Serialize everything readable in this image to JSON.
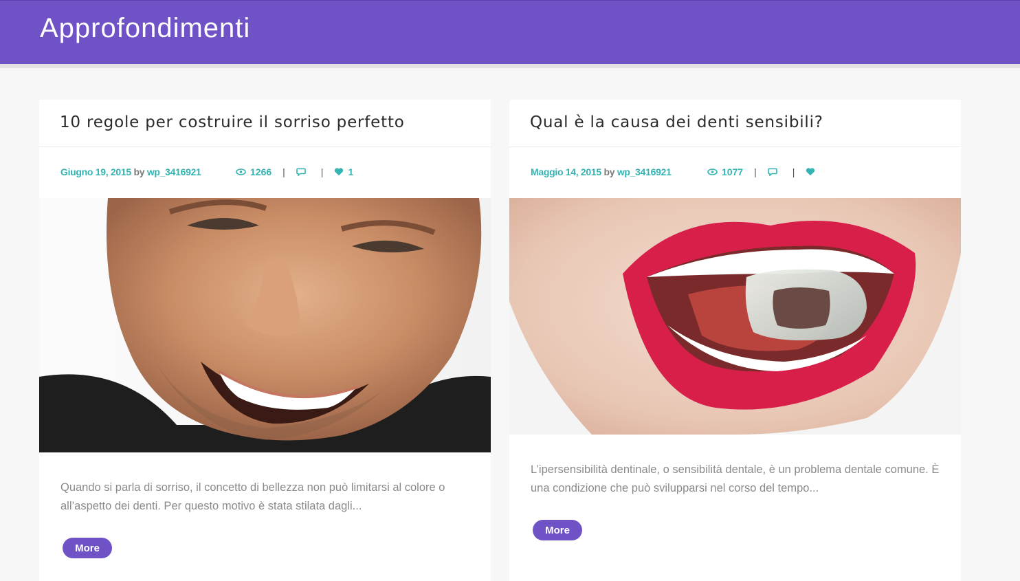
{
  "header": {
    "title": "Approfondimenti"
  },
  "posts": [
    {
      "title": "10 regole per costruire il sorriso perfetto",
      "date": "Giugno 19, 2015",
      "by": "by",
      "author": "wp_3416921",
      "views": "1266",
      "comments": "",
      "likes": "1",
      "excerpt": "Quando si parla di sorriso, il concetto di bellezza non può limitarsi al colore o all’aspetto dei denti. Per questo motivo è stata stilata dagli...",
      "more_label": "More",
      "image": "smiling-man-photo"
    },
    {
      "title": "Qual è la causa dei denti sensibili?",
      "date": "Maggio 14, 2015",
      "by": "by",
      "author": "wp_3416921",
      "views": "1077",
      "comments": "",
      "likes": "",
      "excerpt": "L’ipersensibilità dentinale, o sensibilità dentale, è un problema dentale comune. È una condizione che può svilupparsi nel corso del tempo...",
      "more_label": "More",
      "image": "red-lips-ice-cube-photo"
    }
  ],
  "colors": {
    "accent": "#6f52c6",
    "meta": "#34b3b3"
  }
}
